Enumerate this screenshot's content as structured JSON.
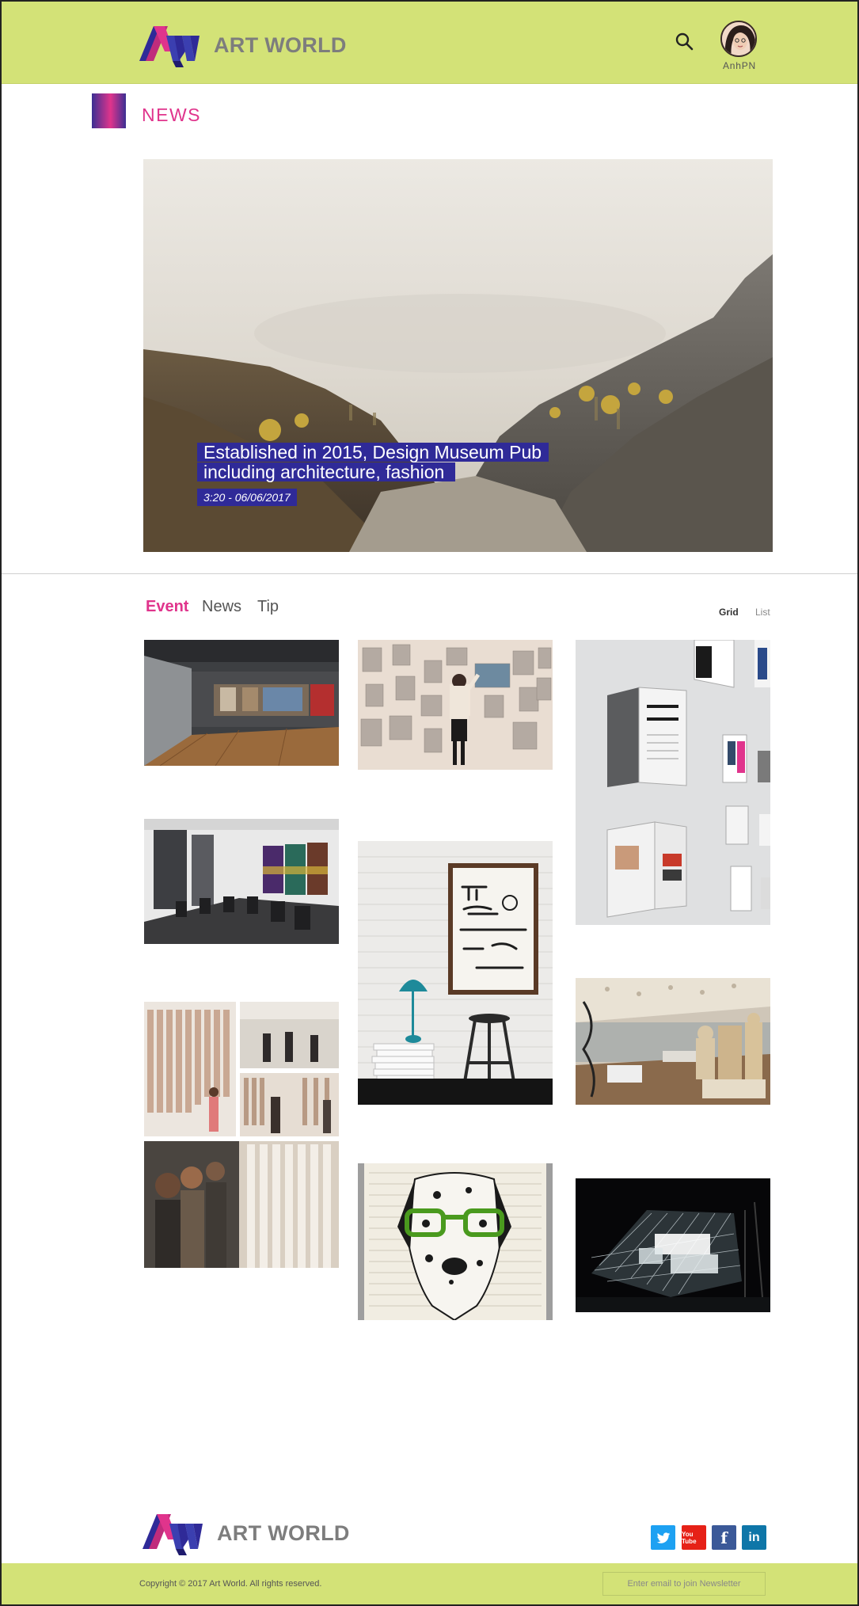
{
  "brand": {
    "name": "ART WORLD",
    "accent": "#e0348c",
    "header_bg": "#d3e277",
    "caption_bg": "#2f2a98"
  },
  "header": {
    "user_name": "AnhPN",
    "icons": [
      "search-icon",
      "avatar"
    ]
  },
  "section": {
    "title": "NEWS"
  },
  "hero": {
    "headline_line1": "Established in 2015, Design Museum Pub",
    "headline_line2": "including architecture, fashion",
    "date": "3:20 - 06/06/2017"
  },
  "tabs": [
    {
      "label": "Event",
      "active": true
    },
    {
      "label": "News",
      "active": false
    },
    {
      "label": "Tip",
      "active": false
    }
  ],
  "view": {
    "grid_label": "Grid",
    "list_label": "List",
    "selected": "Grid"
  },
  "gallery": [
    "museum-hall",
    "gallery-wall-visitor",
    "magazine-wall",
    "meeting-room",
    "coffee-poster",
    "design-exhibition",
    "collage-visitors",
    "dog-poster",
    "night-pavilion"
  ],
  "footer": {
    "brand": "ART WORLD",
    "copyright": "Copyright © 2017 Art World. All rights reserved.",
    "newsletter_placeholder": "Enter email to join Newsletter",
    "social": [
      "twitter",
      "youtube",
      "facebook",
      "linkedin"
    ],
    "youtube_label": "You Tube",
    "facebook_label": "f",
    "linkedin_label": "in"
  }
}
